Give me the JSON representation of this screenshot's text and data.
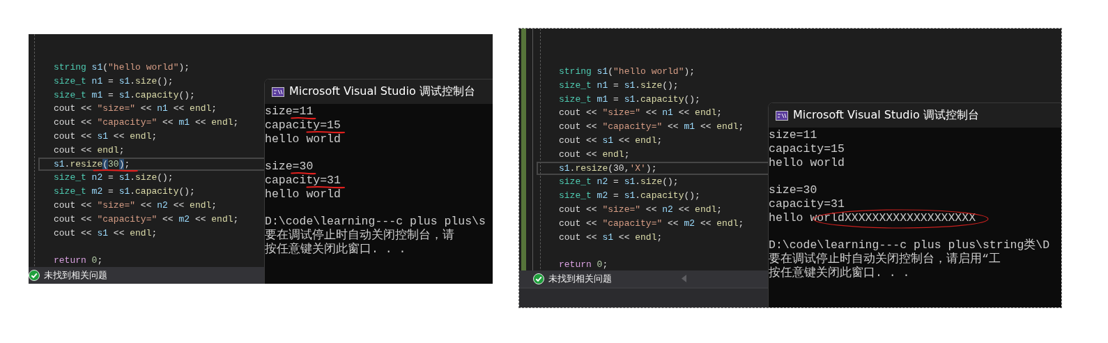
{
  "panels": [
    {
      "editor": {
        "lines": [
          {
            "kind": "code",
            "current": false,
            "underlined": false,
            "tokens": [
              {
                "text": "string ",
                "kind": "type"
              },
              {
                "text": "s1",
                "kind": "var"
              },
              {
                "text": "(",
                "kind": "plain"
              },
              {
                "text": "\"hello world\"",
                "kind": "str"
              },
              {
                "text": ");",
                "kind": "plain"
              }
            ]
          },
          {
            "kind": "code",
            "current": false,
            "underlined": false,
            "tokens": [
              {
                "text": "size_t ",
                "kind": "type"
              },
              {
                "text": "n1",
                "kind": "var"
              },
              {
                "text": " = ",
                "kind": "plain"
              },
              {
                "text": "s1",
                "kind": "var"
              },
              {
                "text": ".",
                "kind": "plain"
              },
              {
                "text": "size",
                "kind": "func"
              },
              {
                "text": "();",
                "kind": "plain"
              }
            ]
          },
          {
            "kind": "code",
            "current": false,
            "underlined": false,
            "tokens": [
              {
                "text": "size_t ",
                "kind": "type"
              },
              {
                "text": "m1",
                "kind": "var"
              },
              {
                "text": " = ",
                "kind": "plain"
              },
              {
                "text": "s1",
                "kind": "var"
              },
              {
                "text": ".",
                "kind": "plain"
              },
              {
                "text": "capacity",
                "kind": "func"
              },
              {
                "text": "();",
                "kind": "plain"
              }
            ]
          },
          {
            "kind": "code",
            "current": false,
            "underlined": false,
            "tokens": [
              {
                "text": "cout << ",
                "kind": "plain"
              },
              {
                "text": "\"size=\"",
                "kind": "str"
              },
              {
                "text": " << ",
                "kind": "plain"
              },
              {
                "text": "n1",
                "kind": "var"
              },
              {
                "text": " << ",
                "kind": "plain"
              },
              {
                "text": "endl",
                "kind": "func"
              },
              {
                "text": ";",
                "kind": "plain"
              }
            ]
          },
          {
            "kind": "code",
            "current": false,
            "underlined": false,
            "tokens": [
              {
                "text": "cout << ",
                "kind": "plain"
              },
              {
                "text": "\"capacity=\"",
                "kind": "str"
              },
              {
                "text": " << ",
                "kind": "plain"
              },
              {
                "text": "m1",
                "kind": "var"
              },
              {
                "text": " << ",
                "kind": "plain"
              },
              {
                "text": "endl",
                "kind": "func"
              },
              {
                "text": ";",
                "kind": "plain"
              }
            ]
          },
          {
            "kind": "code",
            "current": false,
            "underlined": false,
            "tokens": [
              {
                "text": "cout << ",
                "kind": "plain"
              },
              {
                "text": "s1",
                "kind": "var"
              },
              {
                "text": " << ",
                "kind": "plain"
              },
              {
                "text": "endl",
                "kind": "func"
              },
              {
                "text": ";",
                "kind": "plain"
              }
            ]
          },
          {
            "kind": "code",
            "current": false,
            "underlined": false,
            "tokens": [
              {
                "text": "cout << ",
                "kind": "plain"
              },
              {
                "text": "endl",
                "kind": "func"
              },
              {
                "text": ";",
                "kind": "plain"
              }
            ]
          },
          {
            "kind": "code",
            "current": true,
            "underlined": true,
            "tokens": [
              {
                "text": "s1",
                "kind": "var"
              },
              {
                "text": ".",
                "kind": "plain"
              },
              {
                "text": "resize",
                "kind": "func"
              },
              {
                "text": "(",
                "kind": "match"
              },
              {
                "text": "30",
                "kind": "num"
              },
              {
                "text": ")",
                "kind": "match"
              },
              {
                "text": ";",
                "kind": "plain"
              }
            ]
          },
          {
            "kind": "code",
            "current": false,
            "underlined": false,
            "tokens": [
              {
                "text": "size_t ",
                "kind": "type"
              },
              {
                "text": "n2",
                "kind": "var"
              },
              {
                "text": " = ",
                "kind": "plain"
              },
              {
                "text": "s1",
                "kind": "var"
              },
              {
                "text": ".",
                "kind": "plain"
              },
              {
                "text": "size",
                "kind": "func"
              },
              {
                "text": "();",
                "kind": "plain"
              }
            ]
          },
          {
            "kind": "code",
            "current": false,
            "underlined": false,
            "tokens": [
              {
                "text": "size_t ",
                "kind": "type"
              },
              {
                "text": "m2",
                "kind": "var"
              },
              {
                "text": " = ",
                "kind": "plain"
              },
              {
                "text": "s1",
                "kind": "var"
              },
              {
                "text": ".",
                "kind": "plain"
              },
              {
                "text": "capacity",
                "kind": "func"
              },
              {
                "text": "();",
                "kind": "plain"
              }
            ]
          },
          {
            "kind": "code",
            "current": false,
            "underlined": false,
            "tokens": [
              {
                "text": "cout << ",
                "kind": "plain"
              },
              {
                "text": "\"size=\"",
                "kind": "str"
              },
              {
                "text": " << ",
                "kind": "plain"
              },
              {
                "text": "n2",
                "kind": "var"
              },
              {
                "text": " << ",
                "kind": "plain"
              },
              {
                "text": "endl",
                "kind": "func"
              },
              {
                "text": ";",
                "kind": "plain"
              }
            ]
          },
          {
            "kind": "code",
            "current": false,
            "underlined": false,
            "tokens": [
              {
                "text": "cout << ",
                "kind": "plain"
              },
              {
                "text": "\"capacity=\"",
                "kind": "str"
              },
              {
                "text": " << ",
                "kind": "plain"
              },
              {
                "text": "m2",
                "kind": "var"
              },
              {
                "text": " << ",
                "kind": "plain"
              },
              {
                "text": "endl",
                "kind": "func"
              },
              {
                "text": ";",
                "kind": "plain"
              }
            ]
          },
          {
            "kind": "code",
            "current": false,
            "underlined": false,
            "tokens": [
              {
                "text": "cout << ",
                "kind": "plain"
              },
              {
                "text": "s1",
                "kind": "var"
              },
              {
                "text": " << ",
                "kind": "plain"
              },
              {
                "text": "endl",
                "kind": "func"
              },
              {
                "text": ";",
                "kind": "plain"
              }
            ]
          },
          {
            "kind": "blank"
          },
          {
            "kind": "code",
            "current": false,
            "underlined": false,
            "tokens": [
              {
                "text": "return ",
                "kind": "keyword"
              },
              {
                "text": "0",
                "kind": "num"
              },
              {
                "text": ";",
                "kind": "plain"
              }
            ]
          }
        ]
      },
      "status_bar": {
        "text": "未找到相关问题"
      },
      "console": {
        "title": "Microsoft Visual Studio 调试控制台",
        "lines": [
          {
            "kind": "text",
            "text": "size=11",
            "underlined": true
          },
          {
            "kind": "text",
            "text": "capacity=15",
            "underlined": true
          },
          {
            "kind": "text",
            "text": "hello world",
            "underlined": false
          },
          {
            "kind": "blank"
          },
          {
            "kind": "text",
            "text": "size=30",
            "underlined": true
          },
          {
            "kind": "text",
            "text": "capacity=31",
            "underlined": true
          },
          {
            "kind": "text",
            "text": "hello world",
            "underlined": false
          },
          {
            "kind": "blank"
          },
          {
            "kind": "text",
            "text": "D:\\code\\learning---c plus plus\\s",
            "underlined": false
          },
          {
            "kind": "text",
            "text": "要在调试停止时自动关闭控制台，请",
            "underlined": false
          },
          {
            "kind": "text",
            "text": "按任意键关闭此窗口. . .",
            "underlined": false
          }
        ]
      }
    },
    {
      "editor": {
        "lines": [
          {
            "kind": "code",
            "current": false,
            "tokens": [
              {
                "text": "string ",
                "kind": "type"
              },
              {
                "text": "s1",
                "kind": "var"
              },
              {
                "text": "(",
                "kind": "plain"
              },
              {
                "text": "\"hello world\"",
                "kind": "str"
              },
              {
                "text": ");",
                "kind": "plain"
              }
            ]
          },
          {
            "kind": "code",
            "current": false,
            "tokens": [
              {
                "text": "size_t ",
                "kind": "type"
              },
              {
                "text": "n1",
                "kind": "var"
              },
              {
                "text": " = ",
                "kind": "plain"
              },
              {
                "text": "s1",
                "kind": "var"
              },
              {
                "text": ".",
                "kind": "plain"
              },
              {
                "text": "size",
                "kind": "func"
              },
              {
                "text": "();",
                "kind": "plain"
              }
            ]
          },
          {
            "kind": "code",
            "current": false,
            "tokens": [
              {
                "text": "size_t ",
                "kind": "type"
              },
              {
                "text": "m1",
                "kind": "var"
              },
              {
                "text": " = ",
                "kind": "plain"
              },
              {
                "text": "s1",
                "kind": "var"
              },
              {
                "text": ".",
                "kind": "plain"
              },
              {
                "text": "capacity",
                "kind": "func"
              },
              {
                "text": "();",
                "kind": "plain"
              }
            ]
          },
          {
            "kind": "code",
            "current": false,
            "tokens": [
              {
                "text": "cout << ",
                "kind": "plain"
              },
              {
                "text": "\"size=\"",
                "kind": "str"
              },
              {
                "text": " << ",
                "kind": "plain"
              },
              {
                "text": "n1",
                "kind": "var"
              },
              {
                "text": " << ",
                "kind": "plain"
              },
              {
                "text": "endl",
                "kind": "func"
              },
              {
                "text": ";",
                "kind": "plain"
              }
            ]
          },
          {
            "kind": "code",
            "current": false,
            "tokens": [
              {
                "text": "cout << ",
                "kind": "plain"
              },
              {
                "text": "\"capacity=\"",
                "kind": "str"
              },
              {
                "text": " << ",
                "kind": "plain"
              },
              {
                "text": "m1",
                "kind": "var"
              },
              {
                "text": " << ",
                "kind": "plain"
              },
              {
                "text": "endl",
                "kind": "func"
              },
              {
                "text": ";",
                "kind": "plain"
              }
            ]
          },
          {
            "kind": "code",
            "current": false,
            "tokens": [
              {
                "text": "cout << ",
                "kind": "plain"
              },
              {
                "text": "s1",
                "kind": "var"
              },
              {
                "text": " << ",
                "kind": "plain"
              },
              {
                "text": "endl",
                "kind": "func"
              },
              {
                "text": ";",
                "kind": "plain"
              }
            ]
          },
          {
            "kind": "code",
            "current": false,
            "tokens": [
              {
                "text": "cout << ",
                "kind": "plain"
              },
              {
                "text": "endl",
                "kind": "func"
              },
              {
                "text": ";",
                "kind": "plain"
              }
            ]
          },
          {
            "kind": "code",
            "current": true,
            "tokens": [
              {
                "text": "s1",
                "kind": "var"
              },
              {
                "text": ".",
                "kind": "plain"
              },
              {
                "text": "resize",
                "kind": "func"
              },
              {
                "text": "(30,",
                "kind": "plain"
              },
              {
                "text": "'X'",
                "kind": "str"
              },
              {
                "text": ");",
                "kind": "plain"
              }
            ]
          },
          {
            "kind": "code",
            "current": false,
            "tokens": [
              {
                "text": "size_t ",
                "kind": "type"
              },
              {
                "text": "n2",
                "kind": "var"
              },
              {
                "text": " = ",
                "kind": "plain"
              },
              {
                "text": "s1",
                "kind": "var"
              },
              {
                "text": ".",
                "kind": "plain"
              },
              {
                "text": "size",
                "kind": "func"
              },
              {
                "text": "();",
                "kind": "plain"
              }
            ]
          },
          {
            "kind": "code",
            "current": false,
            "tokens": [
              {
                "text": "size_t ",
                "kind": "type"
              },
              {
                "text": "m2",
                "kind": "var"
              },
              {
                "text": " = ",
                "kind": "plain"
              },
              {
                "text": "s1",
                "kind": "var"
              },
              {
                "text": ".",
                "kind": "plain"
              },
              {
                "text": "capacity",
                "kind": "func"
              },
              {
                "text": "();",
                "kind": "plain"
              }
            ]
          },
          {
            "kind": "code",
            "current": false,
            "tokens": [
              {
                "text": "cout << ",
                "kind": "plain"
              },
              {
                "text": "\"size=\"",
                "kind": "str"
              },
              {
                "text": " << ",
                "kind": "plain"
              },
              {
                "text": "n2",
                "kind": "var"
              },
              {
                "text": " << ",
                "kind": "plain"
              },
              {
                "text": "endl",
                "kind": "func"
              },
              {
                "text": ";",
                "kind": "plain"
              }
            ]
          },
          {
            "kind": "code",
            "current": false,
            "tokens": [
              {
                "text": "cout << ",
                "kind": "plain"
              },
              {
                "text": "\"capacity=\"",
                "kind": "str"
              },
              {
                "text": " << ",
                "kind": "plain"
              },
              {
                "text": "m2",
                "kind": "var"
              },
              {
                "text": " << ",
                "kind": "plain"
              },
              {
                "text": "endl",
                "kind": "func"
              },
              {
                "text": ";",
                "kind": "plain"
              }
            ]
          },
          {
            "kind": "code",
            "current": false,
            "tokens": [
              {
                "text": "cout << ",
                "kind": "plain"
              },
              {
                "text": "s1",
                "kind": "var"
              },
              {
                "text": " << ",
                "kind": "plain"
              },
              {
                "text": "endl",
                "kind": "func"
              },
              {
                "text": ";",
                "kind": "plain"
              }
            ]
          },
          {
            "kind": "blank"
          },
          {
            "kind": "code",
            "current": false,
            "tokens": [
              {
                "text": "return ",
                "kind": "keyword"
              },
              {
                "text": "0",
                "kind": "num"
              },
              {
                "text": ";",
                "kind": "plain"
              }
            ]
          }
        ]
      },
      "status_bar": {
        "text": "未找到相关问题"
      },
      "console": {
        "title": "Microsoft Visual Studio 调试控制台",
        "lines": [
          {
            "kind": "text",
            "text": "size=11",
            "circled": false
          },
          {
            "kind": "text",
            "text": "capacity=15",
            "circled": false
          },
          {
            "kind": "text",
            "text": "hello world",
            "circled": false
          },
          {
            "kind": "blank"
          },
          {
            "kind": "text",
            "text": "size=30",
            "circled": false
          },
          {
            "kind": "text",
            "text": "capacity=31",
            "circled": false
          },
          {
            "kind": "text",
            "text": "hello worldXXXXXXXXXXXXXXXXXXX",
            "circled": true
          },
          {
            "kind": "blank"
          },
          {
            "kind": "text",
            "text": "D:\\code\\learning---c plus plus\\string类\\D",
            "circled": false
          },
          {
            "kind": "text",
            "text": "要在调试停止时自动关闭控制台，请启用“工",
            "circled": false
          },
          {
            "kind": "text",
            "text": "按任意键关闭此窗口. . .",
            "circled": false
          }
        ]
      }
    }
  ]
}
